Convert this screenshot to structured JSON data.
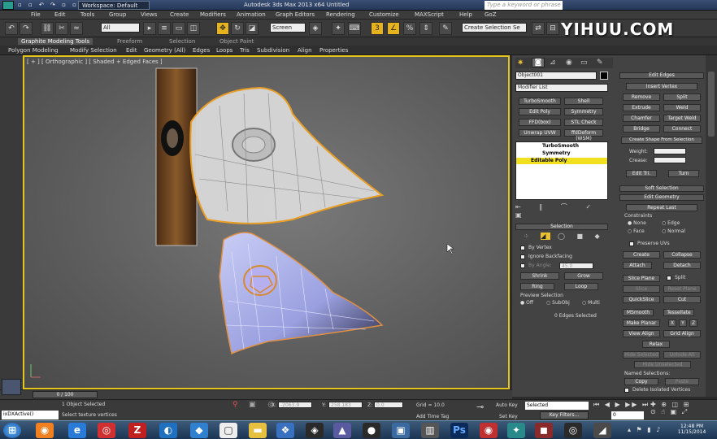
{
  "titlebar": {
    "workspace": "Workspace: Default",
    "title": "Autodesk 3ds Max 2013 x64    Untitled",
    "search_placeholder": "Type a keyword or phrase"
  },
  "menu": [
    "File",
    "Edit",
    "Tools",
    "Group",
    "Views",
    "Create",
    "Modifiers",
    "Animation",
    "Graph Editors",
    "Rendering",
    "Customize",
    "MAXScript",
    "Help",
    "GoZ"
  ],
  "toolbar": {
    "filter": "All",
    "ref_coord": "Screen",
    "sel_set": "Create Selection Se"
  },
  "watermark": "YIHUU.COM",
  "ribbon_tabs": [
    "Graphite Modeling Tools",
    "Freeform",
    "Selection",
    "Object Paint"
  ],
  "ribbon_items": [
    "Polygon Modeling",
    "Modify Selection",
    "Edit",
    "Geometry (All)",
    "Edges",
    "Loops",
    "Tris",
    "Subdivision",
    "Align",
    "Properties"
  ],
  "viewport": {
    "label": "[ + ] [ Orthographic ] [ Shaded + Edged Faces ]"
  },
  "cmd": {
    "object_name": "Object001",
    "modifier_list": "Modifier List",
    "mod_buttons": [
      "TurboSmooth",
      "Shell",
      "Edit Poly",
      "Symmetry",
      "FFD(box)",
      "STL Check",
      "Unwrap UVW",
      "ffdDeform (WSM)"
    ],
    "stack": [
      "TurboSmooth",
      "Symmetry",
      "Editable Poly"
    ]
  },
  "selection": {
    "title": "Selection",
    "by_vertex": "By Vertex",
    "ignore_bf": "Ignore Backfacing",
    "by_angle": "By Angle:",
    "angle_val": "45.0",
    "shrink": "Shrink",
    "grow": "Grow",
    "ring": "Ring",
    "loop": "Loop",
    "preview": "Preview Selection",
    "off": "Off",
    "subobj": "SubObj",
    "multi": "Multi",
    "status": "0 Edges Selected"
  },
  "edit_edges": {
    "title": "Edit Edges",
    "insert": "Insert Vertex",
    "remove": "Remove",
    "split": "Split",
    "extrude": "Extrude",
    "weld": "Weld",
    "chamfer": "Chamfer",
    "target_weld": "Target Weld",
    "bridge": "Bridge",
    "connect": "Connect",
    "create_shape": "Create Shape From Selection",
    "weight": "Weight:",
    "crease": "Crease:",
    "edit_tri": "Edit Tri.",
    "turn": "Turn"
  },
  "soft_sel": "Soft Selection",
  "edit_geom": {
    "title": "Edit Geometry",
    "repeat": "Repeat Last",
    "constraints": "Constraints",
    "none": "None",
    "edge": "Edge",
    "face": "Face",
    "normal": "Normal",
    "preserve": "Preserve UVs",
    "create": "Create",
    "collapse": "Collapse",
    "attach": "Attach",
    "detach": "Detach",
    "slice_plane": "Slice Plane",
    "split": "Split",
    "slice": "Slice",
    "reset_plane": "Reset Plane",
    "quickslice": "QuickSlice",
    "cut": "Cut",
    "msmooth": "MSmooth",
    "tessellate": "Tessellate",
    "make_planar": "Make Planar",
    "x": "X",
    "y": "Y",
    "z": "Z",
    "view_align": "View Align",
    "grid_align": "Grid Align",
    "relax": "Relax",
    "hide_sel": "Hide Selected",
    "unhide_all": "Unhide All",
    "hide_unsel": "Hide Unselected",
    "named": "Named Selections:",
    "copy": "Copy",
    "paste": "Paste",
    "delete_iso": "Delete Isolated Vertices"
  },
  "timeline": {
    "frame": "0 / 100"
  },
  "status": {
    "script": "ixDXActive()",
    "objsel": "1 Object Selected",
    "prompt": "Select texture vertices",
    "x": "-2063.9",
    "y": "258.183",
    "z": "0.0",
    "grid": "Grid = 10.0",
    "addtime": "Add Time Tag",
    "autokey": "Auto Key",
    "selected": "Selected",
    "setkey": "Set Key",
    "keyfilters": "Key Filters...",
    "frame": "0"
  },
  "taskbar": {
    "time": "12:48 PM",
    "date": "11/15/2014"
  }
}
